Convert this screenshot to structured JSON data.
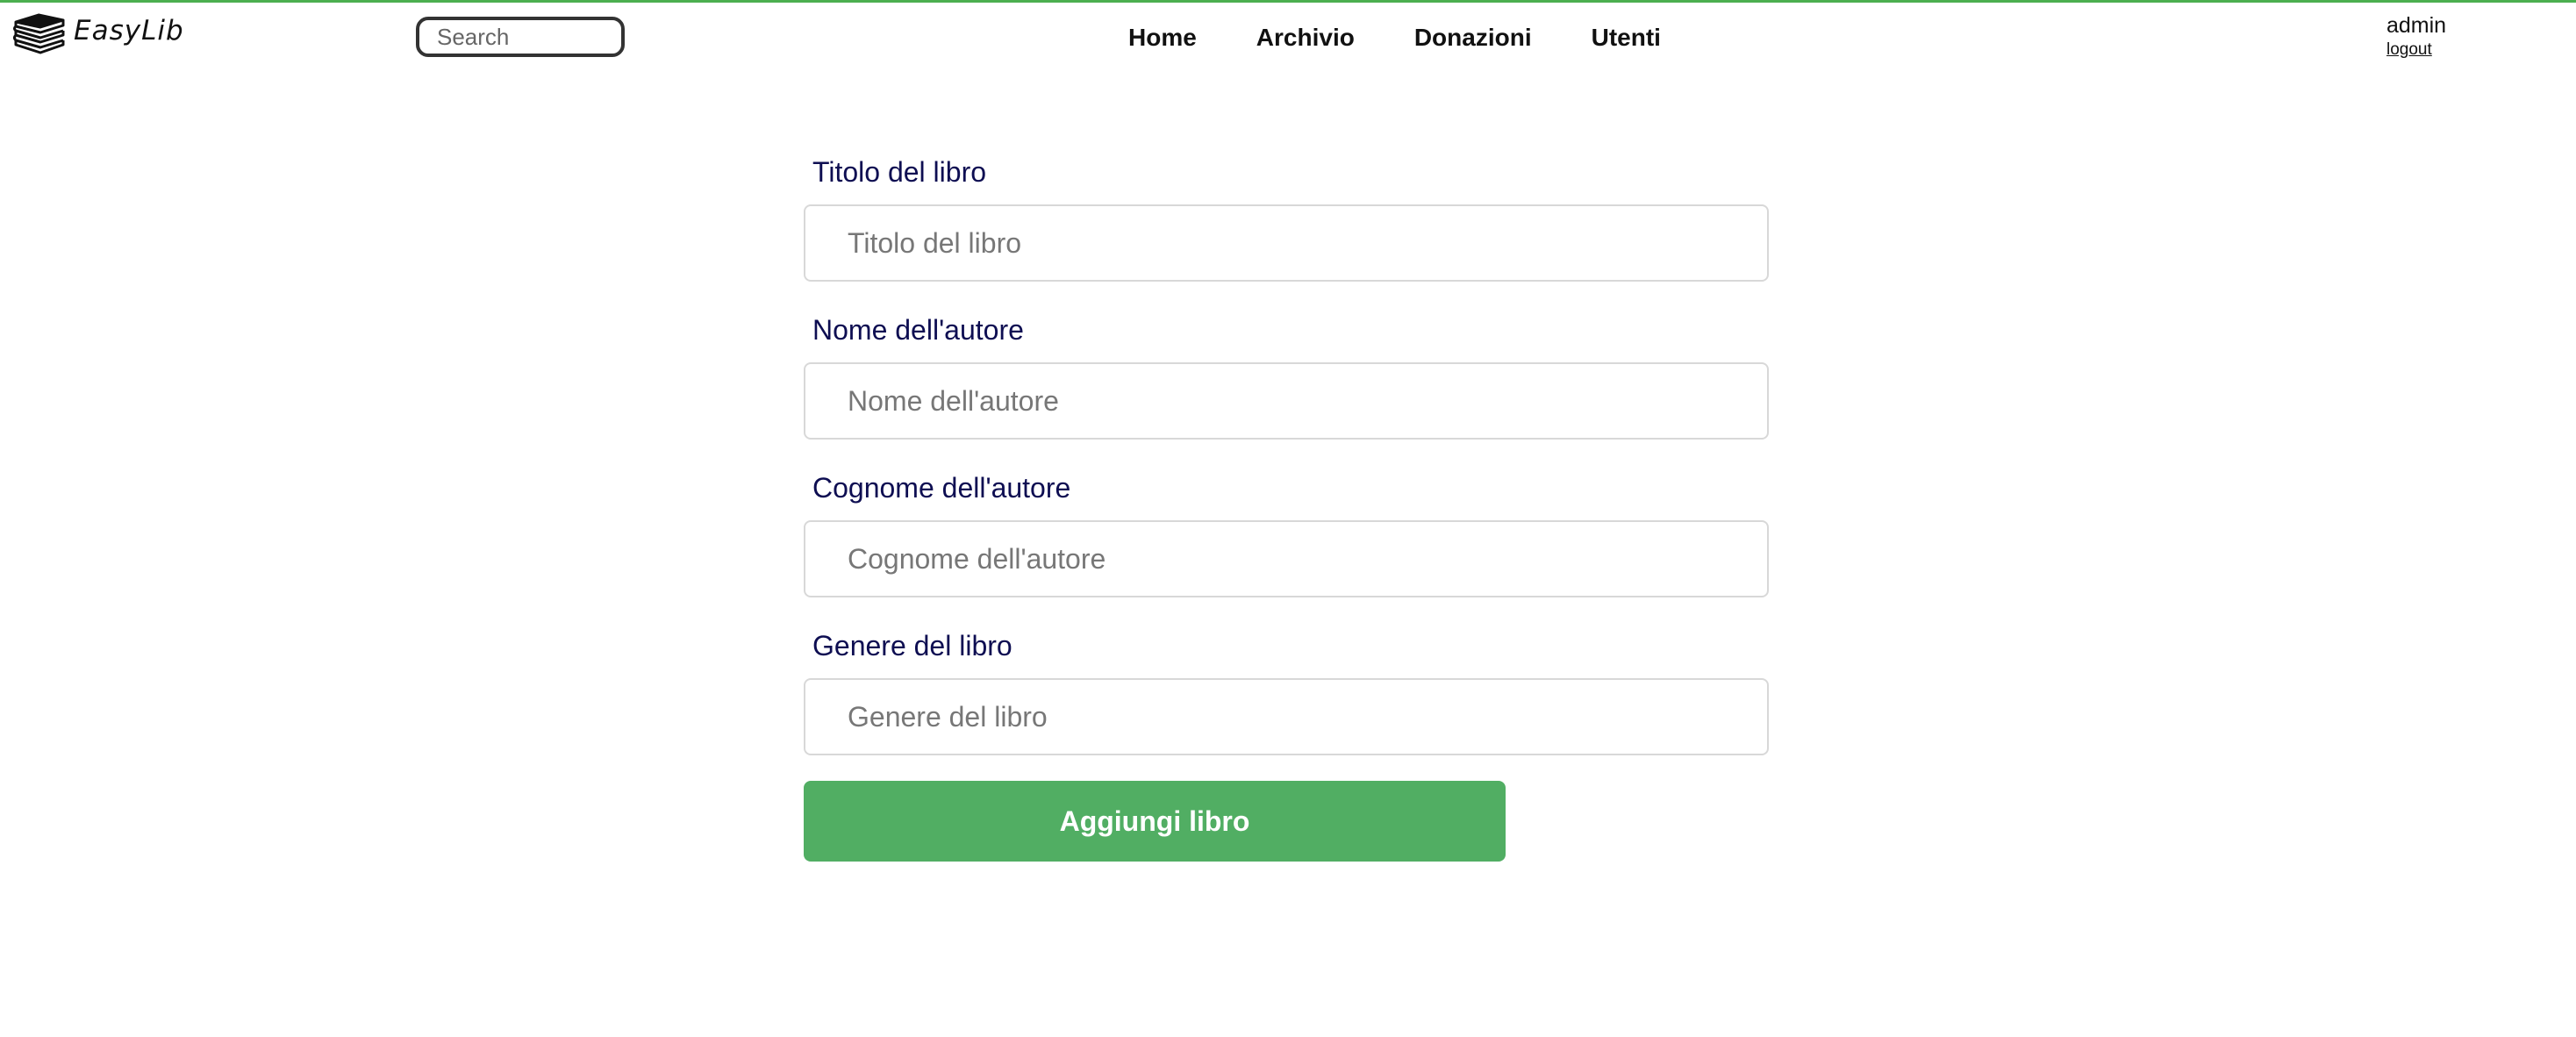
{
  "brand": {
    "name": "EasyLib",
    "icon": "books-stack-icon",
    "accent_color": "#4caf50"
  },
  "search": {
    "placeholder": "Search",
    "value": ""
  },
  "nav": {
    "items": [
      {
        "label": "Home"
      },
      {
        "label": "Archivio"
      },
      {
        "label": "Donazioni"
      },
      {
        "label": "Utenti"
      }
    ]
  },
  "user": {
    "name": "admin",
    "logout_label": "logout"
  },
  "form": {
    "fields": [
      {
        "label": "Titolo del libro",
        "placeholder": "Titolo del libro",
        "value": ""
      },
      {
        "label": "Nome dell'autore",
        "placeholder": "Nome dell'autore",
        "value": ""
      },
      {
        "label": "Cognome dell'autore",
        "placeholder": "Cognome dell'autore",
        "value": ""
      },
      {
        "label": "Genere del libro",
        "placeholder": "Genere del libro",
        "value": ""
      }
    ],
    "submit_label": "Aggiungi libro",
    "submit_color": "#51ae63",
    "label_color": "#0e0e52"
  }
}
